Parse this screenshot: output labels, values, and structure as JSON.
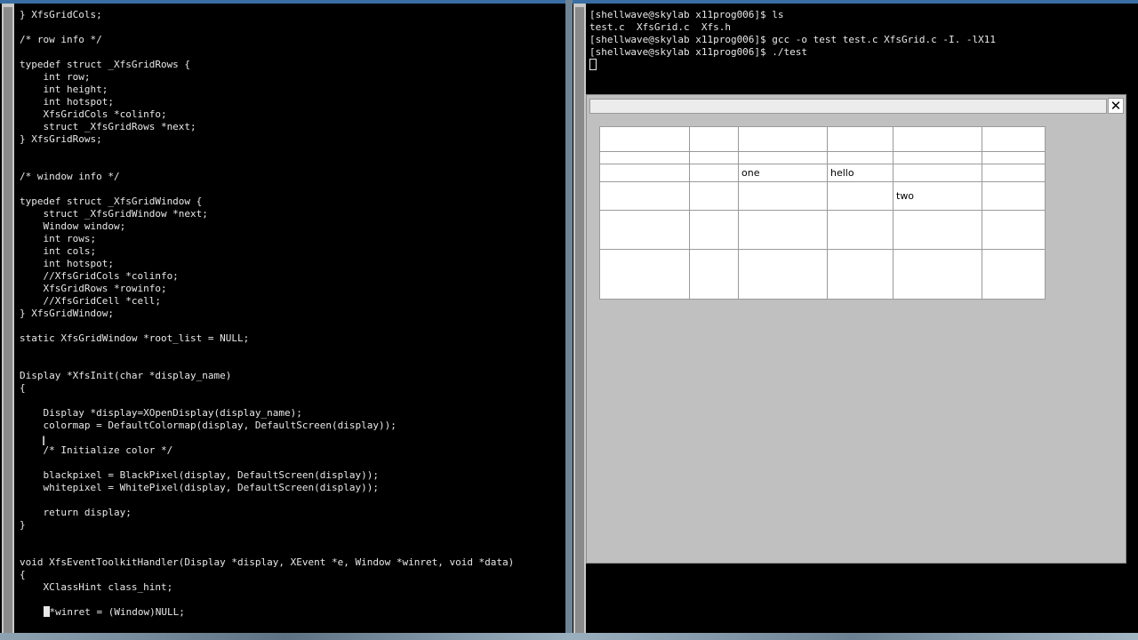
{
  "editor": {
    "lines": [
      "} XfsGridCols;",
      "",
      "/* row info */",
      "",
      "typedef struct _XfsGridRows {",
      "    int row;",
      "    int height;",
      "    int hotspot;",
      "    XfsGridCols *colinfo;",
      "    struct _XfsGridRows *next;",
      "} XfsGridRows;",
      "",
      "",
      "/* window info */",
      "",
      "typedef struct _XfsGridWindow {",
      "    struct _XfsGridWindow *next;",
      "    Window window;",
      "    int rows;",
      "    int cols;",
      "    int hotspot;",
      "    //XfsGridCols *colinfo;",
      "    XfsGridRows *rowinfo;",
      "    //XfsGridCell *cell;",
      "} XfsGridWindow;",
      "",
      "static XfsGridWindow *root_list = NULL;",
      "",
      "",
      "Display *XfsInit(char *display_name)",
      "{",
      "",
      "    Display *display=XOpenDisplay(display_name);",
      "    colormap = DefaultColormap(display, DefaultScreen(display));",
      "",
      "    /* Initialize color */",
      "",
      "    blackpixel = BlackPixel(display, DefaultScreen(display));",
      "    whitepixel = WhitePixel(display, DefaultScreen(display));",
      "",
      "    return display;",
      "}",
      "",
      "",
      "void XfsEventToolkitHandler(Display *display, XEvent *e, Window *winret, void *data)",
      "{",
      "    XClassHint class_hint;",
      ""
    ],
    "cursor_line_prefix": "    ",
    "cursor_line_rest": "*winret = (Window)NULL;",
    "ibeam": "I"
  },
  "shell": {
    "lines": [
      "[shellwave@skylab x11prog006]$ ls",
      "test.c  XfsGrid.c  Xfs.h",
      "[shellwave@skylab x11prog006]$ gcc -o test test.c XfsGrid.c -I. -lX11",
      "[shellwave@skylab x11prog006]$ ./test"
    ]
  },
  "test_window": {
    "close_glyph": "✕",
    "grid": {
      "rows": [
        [
          "",
          "",
          "",
          "",
          "",
          ""
        ],
        [
          "",
          "",
          "",
          "",
          "",
          ""
        ],
        [
          "",
          "",
          "one",
          "hello",
          "",
          ""
        ],
        [
          "",
          "",
          "",
          "",
          "two",
          ""
        ],
        [
          "",
          "",
          "",
          "",
          "",
          ""
        ],
        [
          "",
          "",
          "",
          "",
          "",
          ""
        ]
      ]
    }
  }
}
